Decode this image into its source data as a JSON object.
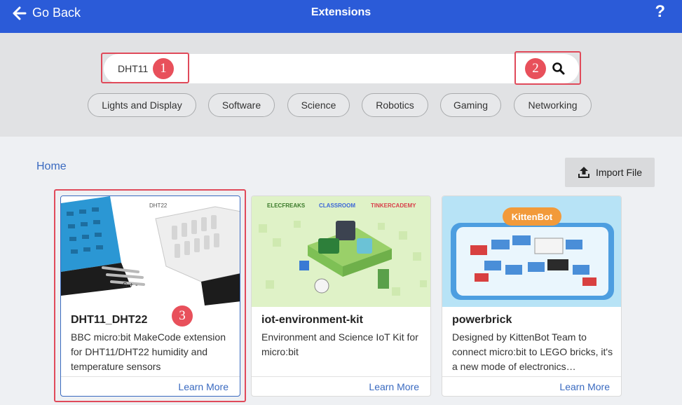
{
  "header": {
    "back_label": "Go Back",
    "title": "Extensions",
    "help_label": "?"
  },
  "search": {
    "value": "DHT11"
  },
  "categories": [
    "Lights and Display",
    "Software",
    "Science",
    "Robotics",
    "Gaming",
    "Networking"
  ],
  "breadcrumb": {
    "home": "Home"
  },
  "import_label": "Import File",
  "annotations": [
    "1",
    "2",
    "3"
  ],
  "cards": [
    {
      "name": "DHT11_DHT22",
      "desc": "BBC micro:bit MakeCode extension for DHT11/DHT22 humidity and temperature sensors",
      "link": "Learn More",
      "img_label": "DHT22"
    },
    {
      "name": "iot-environment-kit",
      "desc": "Environment and Science IoT Kit for micro:bit",
      "link": "Learn More",
      "logos": [
        "ELECFREAKS",
        "CLASSROOM",
        "TINKERCADEMY"
      ]
    },
    {
      "name": "powerbrick",
      "desc": "Designed by KittenBot Team to connect micro:bit to LEGO bricks, it's a new mode of electronics…",
      "link": "Learn More",
      "logo": "KittenBot"
    }
  ],
  "colors": {
    "header": "#2b5bd8",
    "highlight": "#e04a5a",
    "link": "#3a6ac0"
  }
}
